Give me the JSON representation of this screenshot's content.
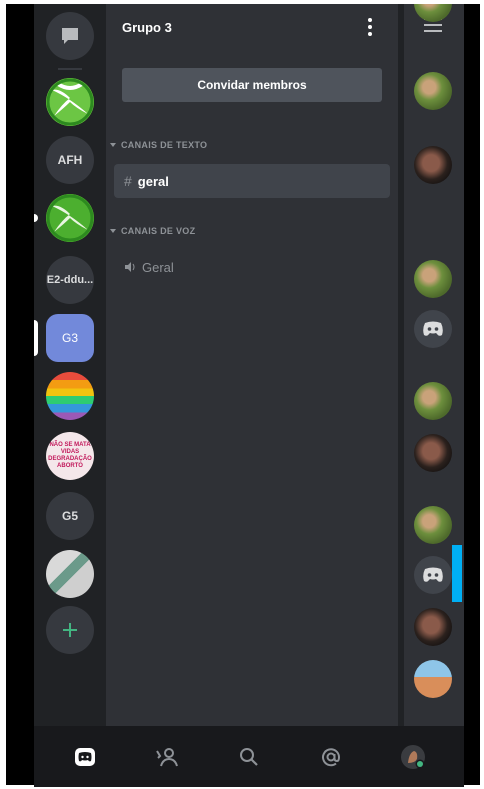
{
  "guild": {
    "name": "Grupo 3",
    "invite_label": "Convidar membros"
  },
  "servers": [
    {
      "id": "afh",
      "label": "AFH"
    },
    {
      "id": "e2",
      "label": "E2-ddu..."
    },
    {
      "id": "g3",
      "label": "G3",
      "selected": true
    },
    {
      "id": "g5",
      "label": "G5"
    }
  ],
  "badge_text": [
    "NÃO SE MATA",
    "VIDAS",
    "DEGRADAÇÃO",
    "ABORTO"
  ],
  "categories": {
    "text": "CANAIS DE TEXTO",
    "voice": "CANAIS DE VOZ"
  },
  "channels": {
    "text": [
      {
        "name": "geral",
        "active": true
      }
    ],
    "voice": [
      {
        "name": "Geral"
      }
    ]
  },
  "icons": {
    "dm": "chat-bubble-icon",
    "add": "plus-icon",
    "menu": "kebab-menu-icon",
    "members": "hamburger-icon",
    "tabs": [
      "discord-home-icon",
      "friends-icon",
      "search-icon",
      "mentions-icon",
      "profile-avatar-icon"
    ]
  },
  "colors": {
    "accent": "#7289da",
    "add_green": "#43b581",
    "scroll_blue": "#00aff4"
  }
}
